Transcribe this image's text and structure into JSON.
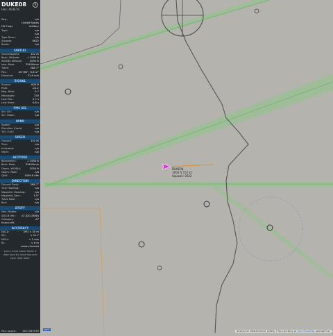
{
  "aircraft": {
    "callsign": "DUKE08",
    "hex_label": "Hex:",
    "hex": "AE4E78"
  },
  "sections": {
    "general": [
      {
        "k": "Reg.:",
        "v": "n/a"
      },
      {
        "k": "",
        "v": "United States"
      },
      {
        "k": "DB Flags:",
        "v": "military"
      },
      {
        "k": "Type:",
        "v": "n/a"
      },
      {
        "k": "",
        "v": "n/a"
      },
      {
        "k": "Type Desc.:",
        "v": "n/a"
      },
      {
        "k": "Squawk:",
        "v": "0622"
      },
      {
        "k": "Route:",
        "v": "n/a"
      }
    ],
    "spatial_title": "SPATIAL",
    "spatial": [
      {
        "k": "Groundspeed:",
        "v": "152 kt"
      },
      {
        "k": "Baro. Altitude:",
        "v": "↓ 1950 ft"
      },
      {
        "k": "WGS84 altitude:",
        "v": "2050 ft"
      },
      {
        "k": "Vert. Rate:",
        "v": "256 ft/min"
      },
      {
        "k": "Track:",
        "v": "288.7°"
      },
      {
        "k": "Pos.:",
        "v": "49.762°, 6.512°"
      },
      {
        "k": "Distance:",
        "v": "31.6 nmi"
      }
    ],
    "signal_title": "SIGNAL",
    "signal": [
      {
        "k": "Source:",
        "v": "ADS-B"
      },
      {
        "k": "RSSI:",
        "v": "-14.2"
      },
      {
        "k": "Msg. Rate:",
        "v": "0.7"
      },
      {
        "k": "Messages:",
        "v": "235"
      },
      {
        "k": "Last Pos.:",
        "v": "2.7 s"
      },
      {
        "k": "Last Seen:",
        "v": "0.8 s"
      }
    ],
    "fms_title": "FMS SEL",
    "fms": [
      {
        "k": "Sel. Alt.:",
        "v": "n/a"
      },
      {
        "k": "Sel. Head.:",
        "v": "n/a"
      }
    ],
    "wind_title": "WIND",
    "wind": [
      {
        "k": "Speed:",
        "v": "n/a"
      },
      {
        "k": "Direction (from):",
        "v": "n/a"
      },
      {
        "k": "TAT / OAT:",
        "v": "n/a"
      }
    ],
    "speed_title": "SPEED",
    "speed": [
      {
        "k": "Ground:",
        "v": "152 kt"
      },
      {
        "k": "True:",
        "v": "n/a"
      },
      {
        "k": "Indicated:",
        "v": "n/a"
      },
      {
        "k": "Mach:",
        "v": "n/a"
      }
    ],
    "altitude_title": "ALTITUDE",
    "altitude": [
      {
        "k": "Barometric:",
        "v": "↓ 1950 ft"
      },
      {
        "k": "Baro. Rate:",
        "v": "256 ft/min"
      },
      {
        "k": "Geom. WGS84:",
        "v": "2050 ft"
      },
      {
        "k": "Geom. Rate:",
        "v": "n/a"
      },
      {
        "k": "QNH:",
        "v": "1009.6 hPa"
      }
    ],
    "direction_title": "DIRECTION",
    "direction": [
      {
        "k": "Ground Track:",
        "v": "288.7°"
      },
      {
        "k": "True Heading:",
        "v": "n/a"
      },
      {
        "k": "Magnetic Heading:",
        "v": "n/a"
      },
      {
        "k": "Magnetic Decl.:",
        "v": "3.5°"
      },
      {
        "k": "Track Rate:",
        "v": "n/a"
      },
      {
        "k": "Roll:",
        "v": "n/a"
      }
    ],
    "stuff_title": "STUFF",
    "stuff": [
      {
        "k": "Nav. Modes:",
        "v": "n/a"
      },
      {
        "k": "ADS-B Ver.:",
        "v": "v2 (DO-260B)"
      },
      {
        "k": "Category:",
        "v": "A7"
      },
      {
        "k": "Rotorcraft:",
        "v": ""
      }
    ],
    "accuracy_title": "ACCURACY",
    "accuracy": [
      {
        "k": "NACp:",
        "v": "EPU < 30 m"
      },
      {
        "k": "SIL:",
        "v": "< 1e-7"
      },
      {
        "k": "NACv:",
        "v": "< 3 m/s"
      },
      {
        "k": "Rc:",
        "v": "< 8 m"
      },
      {
        "k": "",
        "v": "cross-checked"
      }
    ],
    "note": "Learn more about Mode S data type by hovering over each data label.",
    "pos_epoch_label": "Pos. epoch:",
    "pos_epoch": "1651385949"
  },
  "map": {
    "aircraft_label_lines": [
      "DUKE08",
      "1950 ft 152 kt",
      "Squawk: 0622"
    ],
    "attribution_prefix": "Deutscher Wetterdienst (DWD) Tiles courtesy of",
    "attribution_link": "OpenTopoMap",
    "attribution_suffix": "openAIP.net",
    "scale_badge": "nmi"
  },
  "colors": {
    "sidebar_bg": "#24292d",
    "section_header": "#1a4a70",
    "map_bg": "#b4b3ad",
    "airway_green": "#8fc48a",
    "aircraft_magenta": "#e030e0"
  }
}
